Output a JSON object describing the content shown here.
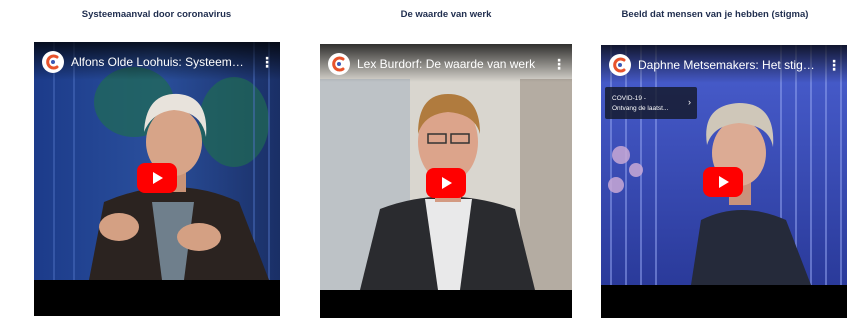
{
  "colors": {
    "title_text": "#1f2d4e",
    "play_button": "#ff0000",
    "logo_accent": "#e8532c"
  },
  "videos": [
    {
      "section_title": "Systeemaanval door coronavirus",
      "video_title": "Alfons Olde Loohuis: Systeemaanv...",
      "channel_icon": "channel-logo-icon",
      "more_icon": "more-vert-icon",
      "play_icon": "youtube-play-icon"
    },
    {
      "section_title": "De waarde van werk",
      "video_title": "Lex Burdorf: De waarde van werk",
      "channel_icon": "channel-logo-icon",
      "more_icon": "more-vert-icon",
      "play_icon": "youtube-play-icon"
    },
    {
      "section_title": "Beeld dat mensen van je hebben (stigma)",
      "video_title": "Daphne Metsemakers: Het stigma ...",
      "channel_icon": "channel-logo-icon",
      "more_icon": "more-vert-icon",
      "play_icon": "youtube-play-icon",
      "info_card": {
        "line1": "COVID-19 -",
        "line2": "Ontvang de laatst...",
        "chevron": "›"
      }
    }
  ]
}
